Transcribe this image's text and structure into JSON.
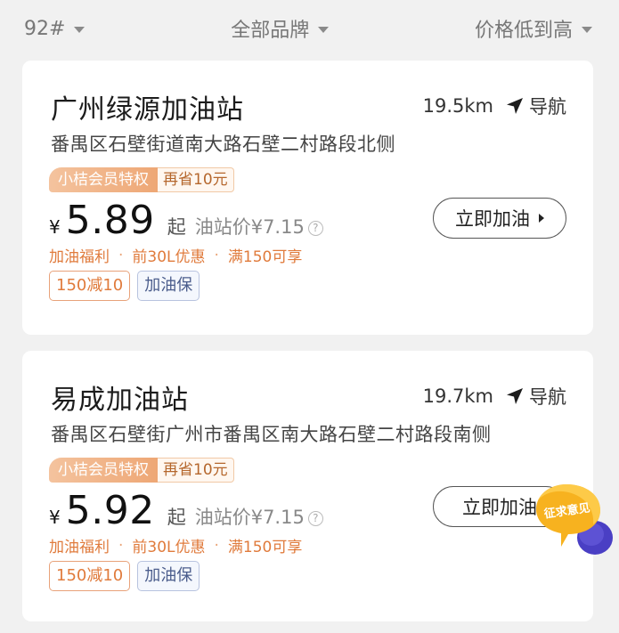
{
  "filters": {
    "fuel": "92#",
    "brand": "全部品牌",
    "sort": "价格低到高"
  },
  "stations": [
    {
      "name": "广州绿源加油站",
      "distance": "19.5km",
      "nav_label": "导航",
      "address": "番禺区石壁街道南大路石壁二村路段北侧",
      "member_label": "小桔会员特权",
      "save_label": "再省10元",
      "currency": "¥",
      "price": "5.89",
      "qi": "起",
      "station_price": "油站价¥7.15",
      "help": "?",
      "benefit_title": "加油福利",
      "benefit_1": "前30L优惠",
      "benefit_2": "满150可享",
      "tag_1": "150减10",
      "tag_2": "加油保",
      "button": "立即加油"
    },
    {
      "name": "易成加油站",
      "distance": "19.7km",
      "nav_label": "导航",
      "address": "番禺区石壁街广州市番禺区南大路石壁二村路段南侧",
      "member_label": "小桔会员特权",
      "save_label": "再省10元",
      "currency": "¥",
      "price": "5.92",
      "qi": "起",
      "station_price": "油站价¥7.15",
      "help": "?",
      "benefit_title": "加油福利",
      "benefit_1": "前30L优惠",
      "benefit_2": "满150可享",
      "tag_1": "150减10",
      "tag_2": "加油保",
      "button": "立即加油"
    }
  ],
  "feedback": {
    "label": "征求意见",
    "colors": {
      "bubble": "#f7b21f",
      "bubble_dark": "#e38c0c",
      "bubble2": "#4a3fc4"
    }
  },
  "colors": {
    "background": "#f1f1f1",
    "accent_orange": "#e07b3c",
    "member_gradient": "#eea775",
    "tag_blue": "#4b5d8c"
  },
  "separator_dot": "·"
}
